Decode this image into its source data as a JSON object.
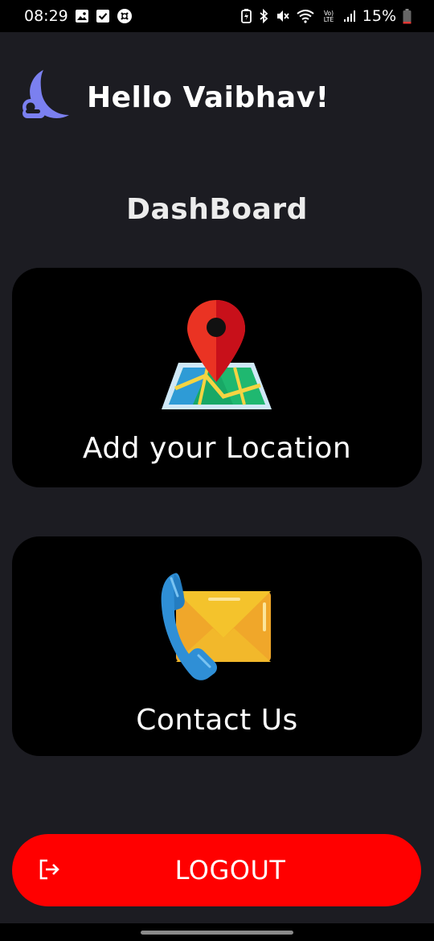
{
  "status_bar": {
    "time": "08:29",
    "left_icons": [
      "gallery-icon",
      "check-icon",
      "app-notification-icon"
    ],
    "right_icons": [
      "battery-saver-icon",
      "bluetooth-icon",
      "mute-icon",
      "wifi-icon",
      "volte-icon",
      "signal-icon"
    ],
    "battery_text": "15%",
    "battery_level": 0.15
  },
  "header": {
    "logo_icon": "moon-cloud-icon",
    "greeting": "Hello Vaibhav!"
  },
  "page_title": "DashBoard",
  "cards": [
    {
      "icon": "map-pin-icon",
      "label": "Add your Location"
    },
    {
      "icon": "phone-mail-icon",
      "label": "Contact Us"
    }
  ],
  "logout": {
    "icon": "logout-icon",
    "label": "LOGOUT"
  },
  "colors": {
    "background": "#1c1c22",
    "card": "#000000",
    "logout": "#ff0000",
    "logo": "#7b80f0",
    "text": "#ffffff"
  }
}
